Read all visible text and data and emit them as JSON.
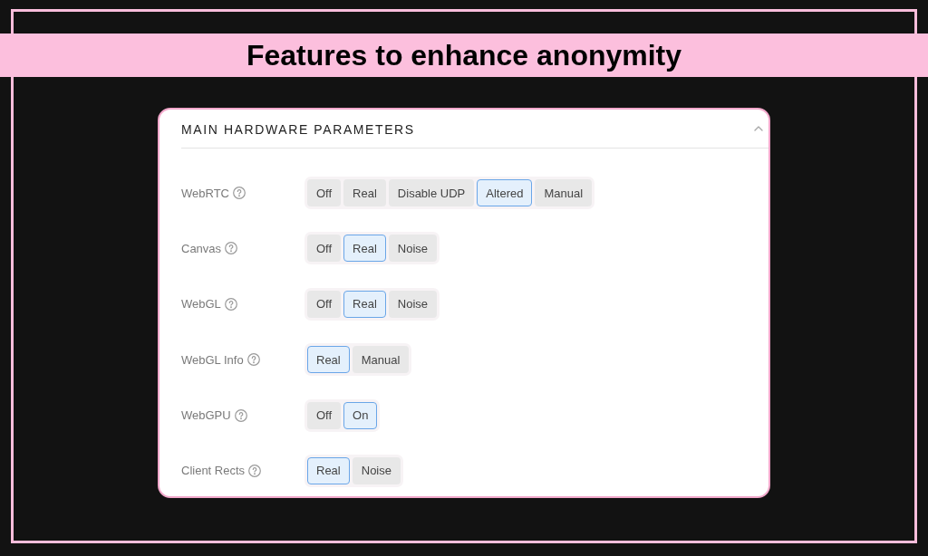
{
  "title": "Features to enhance anonymity",
  "panel": {
    "title": "MAIN HARDWARE PARAMETERS",
    "expanded": true,
    "settings": [
      {
        "label": "WebRTC",
        "options": [
          {
            "label": "Off",
            "selected": false
          },
          {
            "label": "Real",
            "selected": false
          },
          {
            "label": "Disable UDP",
            "selected": false
          },
          {
            "label": "Altered",
            "selected": true
          },
          {
            "label": "Manual",
            "selected": false
          }
        ]
      },
      {
        "label": "Canvas",
        "options": [
          {
            "label": "Off",
            "selected": false
          },
          {
            "label": "Real",
            "selected": true
          },
          {
            "label": "Noise",
            "selected": false
          }
        ]
      },
      {
        "label": "WebGL",
        "options": [
          {
            "label": "Off",
            "selected": false
          },
          {
            "label": "Real",
            "selected": true
          },
          {
            "label": "Noise",
            "selected": false
          }
        ]
      },
      {
        "label": "WebGL Info",
        "options": [
          {
            "label": "Real",
            "selected": true
          },
          {
            "label": "Manual",
            "selected": false
          }
        ]
      },
      {
        "label": "WebGPU",
        "options": [
          {
            "label": "Off",
            "selected": false
          },
          {
            "label": "On",
            "selected": true
          }
        ]
      },
      {
        "label": "Client Rects",
        "options": [
          {
            "label": "Real",
            "selected": true
          },
          {
            "label": "Noise",
            "selected": false
          }
        ]
      }
    ]
  }
}
